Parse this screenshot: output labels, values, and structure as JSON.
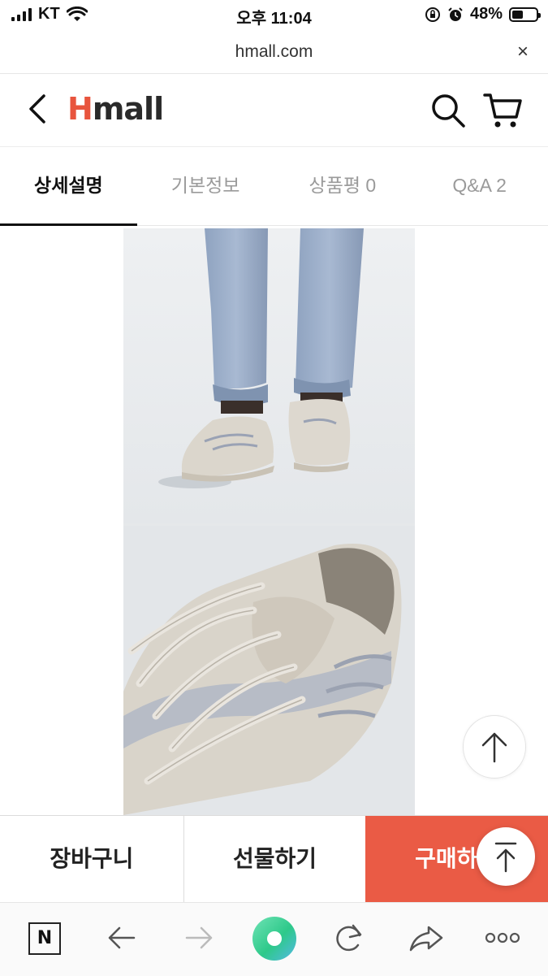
{
  "status_bar": {
    "carrier": "KT",
    "time": "오후 11:04",
    "battery": "48%",
    "battery_level": 0.48
  },
  "browser": {
    "url": "hmall.com",
    "close_label": "×"
  },
  "header": {
    "logo_h": "H",
    "logo_rest": "mall",
    "icons": [
      "back-arrow-icon",
      "search-icon",
      "cart-icon"
    ],
    "brand_color": "#e8553e"
  },
  "tabs": [
    {
      "label": "상세설명",
      "active": true
    },
    {
      "label": "기본정보",
      "active": false
    },
    {
      "label": "상품평 0",
      "active": false
    },
    {
      "label": "Q&A 2",
      "active": false
    }
  ],
  "actions": {
    "cart": "장바구니",
    "gift": "선물하기",
    "buy": "구매하기",
    "buy_color": "#ea5b45"
  },
  "browser_toolbar": {
    "n_label": "N",
    "icons": [
      "naver-n-icon",
      "back-icon",
      "forward-icon",
      "green-dot-icon",
      "reload-icon",
      "share-icon",
      "more-icon"
    ]
  }
}
